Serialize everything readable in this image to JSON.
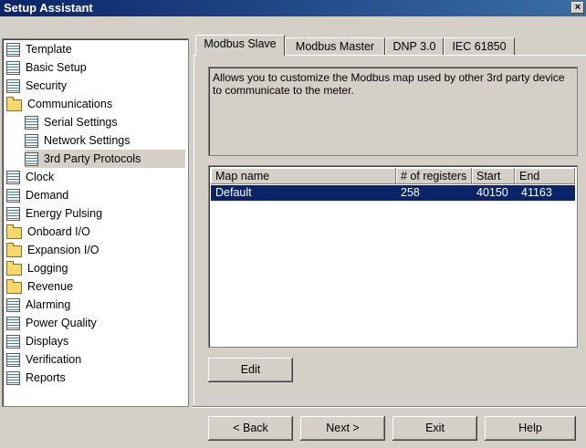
{
  "window": {
    "title": "Setup Assistant",
    "close_glyph": "×"
  },
  "tree": {
    "items": [
      {
        "label": "Template",
        "icon": "doc-icon"
      },
      {
        "label": "Basic Setup",
        "icon": "doc-icon"
      },
      {
        "label": "Security",
        "icon": "doc-icon"
      },
      {
        "label": "Communications",
        "icon": "folder-icon"
      },
      {
        "label": "Serial Settings",
        "icon": "doc-icon"
      },
      {
        "label": "Network Settings",
        "icon": "doc-icon"
      },
      {
        "label": "3rd Party Protocols",
        "icon": "doc-icon",
        "selected": true
      },
      {
        "label": "Clock",
        "icon": "doc-icon"
      },
      {
        "label": "Demand",
        "icon": "doc-icon"
      },
      {
        "label": "Energy Pulsing",
        "icon": "doc-icon"
      },
      {
        "label": "Onboard I/O",
        "icon": "folder-icon"
      },
      {
        "label": "Expansion I/O",
        "icon": "folder-icon"
      },
      {
        "label": "Logging",
        "icon": "folder-icon"
      },
      {
        "label": "Revenue",
        "icon": "folder-icon"
      },
      {
        "label": "Alarming",
        "icon": "doc-icon"
      },
      {
        "label": "Power Quality",
        "icon": "doc-icon"
      },
      {
        "label": "Displays",
        "icon": "doc-icon"
      },
      {
        "label": "Verification",
        "icon": "doc-icon"
      },
      {
        "label": "Reports",
        "icon": "doc-icon"
      }
    ]
  },
  "tabs": [
    {
      "label": "Modbus Slave",
      "active": true
    },
    {
      "label": "Modbus Master"
    },
    {
      "label": "DNP 3.0"
    },
    {
      "label": "IEC 61850"
    }
  ],
  "description": "Allows you to customize the Modbus map used by other 3rd party device to communicate to the meter.",
  "map_table": {
    "headers": [
      "Map name",
      "# of registers",
      "Start",
      "End"
    ],
    "rows": [
      {
        "name": "Default",
        "registers": "258",
        "start": "40150",
        "end": "41163",
        "selected": true
      }
    ]
  },
  "buttons": {
    "edit": "Edit",
    "back": "< Back",
    "next": "Next >",
    "exit": "Exit",
    "help": "Help"
  },
  "colors": {
    "title_bar": "#0a246a",
    "selection": "#0a246a",
    "face": "#d4d0c8"
  }
}
